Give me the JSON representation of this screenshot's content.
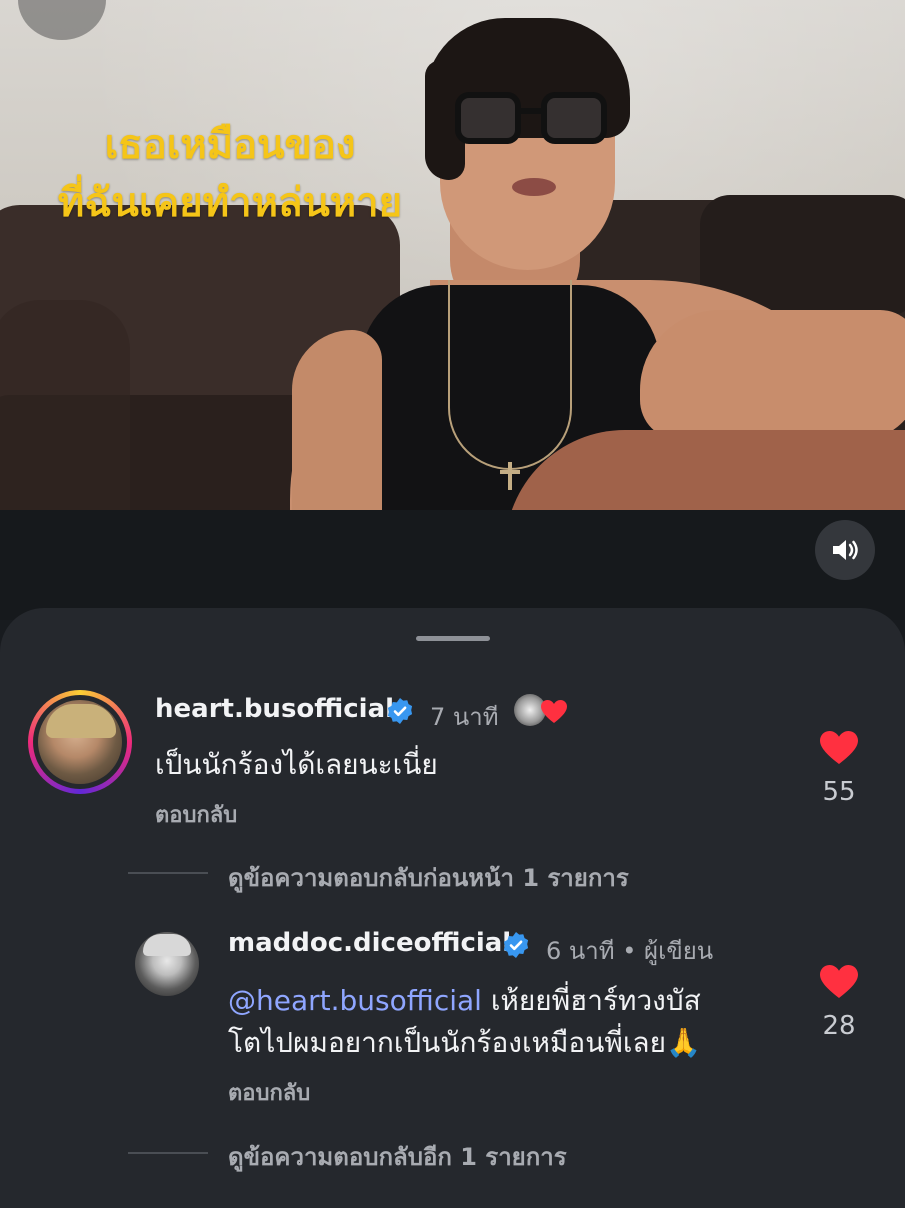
{
  "video": {
    "lyrics": [
      "เธอเหมือนของ",
      "ที่ฉันเคยทำหล่นหาย"
    ]
  },
  "comments": [
    {
      "username": "heart.busofficial",
      "time": "7 นาที",
      "text": "เป็นนักร้องได้เลยนะเนี่ย",
      "reply_label": "ตอบกลับ",
      "likes": "55"
    },
    {
      "username": "maddoc.diceofficial",
      "time": "6 นาที",
      "author_sep": "•",
      "author_label": "ผู้เขียน",
      "mention": "@heart.busofficial",
      "text_line1": " เห้ยยพี่ฮาร์ทวงบัส",
      "text_line2": "โตไปผมอยากเป็นนักร้องเหมือนพี่เลย🙏",
      "reply_label": "ตอบกลับ",
      "likes": "28"
    }
  ],
  "threads": {
    "previous_replies": "ดูข้อความตอบกลับก่อนหน้า 1 รายการ",
    "more_replies": "ดูข้อความตอบกลับอีก 1 รายการ"
  },
  "colors": {
    "accent_like": "#ff3040",
    "verified": "#3897f0",
    "lyrics": "#f5c518",
    "mention": "#8fa6ff"
  },
  "icons": {
    "sound": "speaker-icon",
    "like": "heart-icon",
    "verified": "verified-badge-icon"
  }
}
